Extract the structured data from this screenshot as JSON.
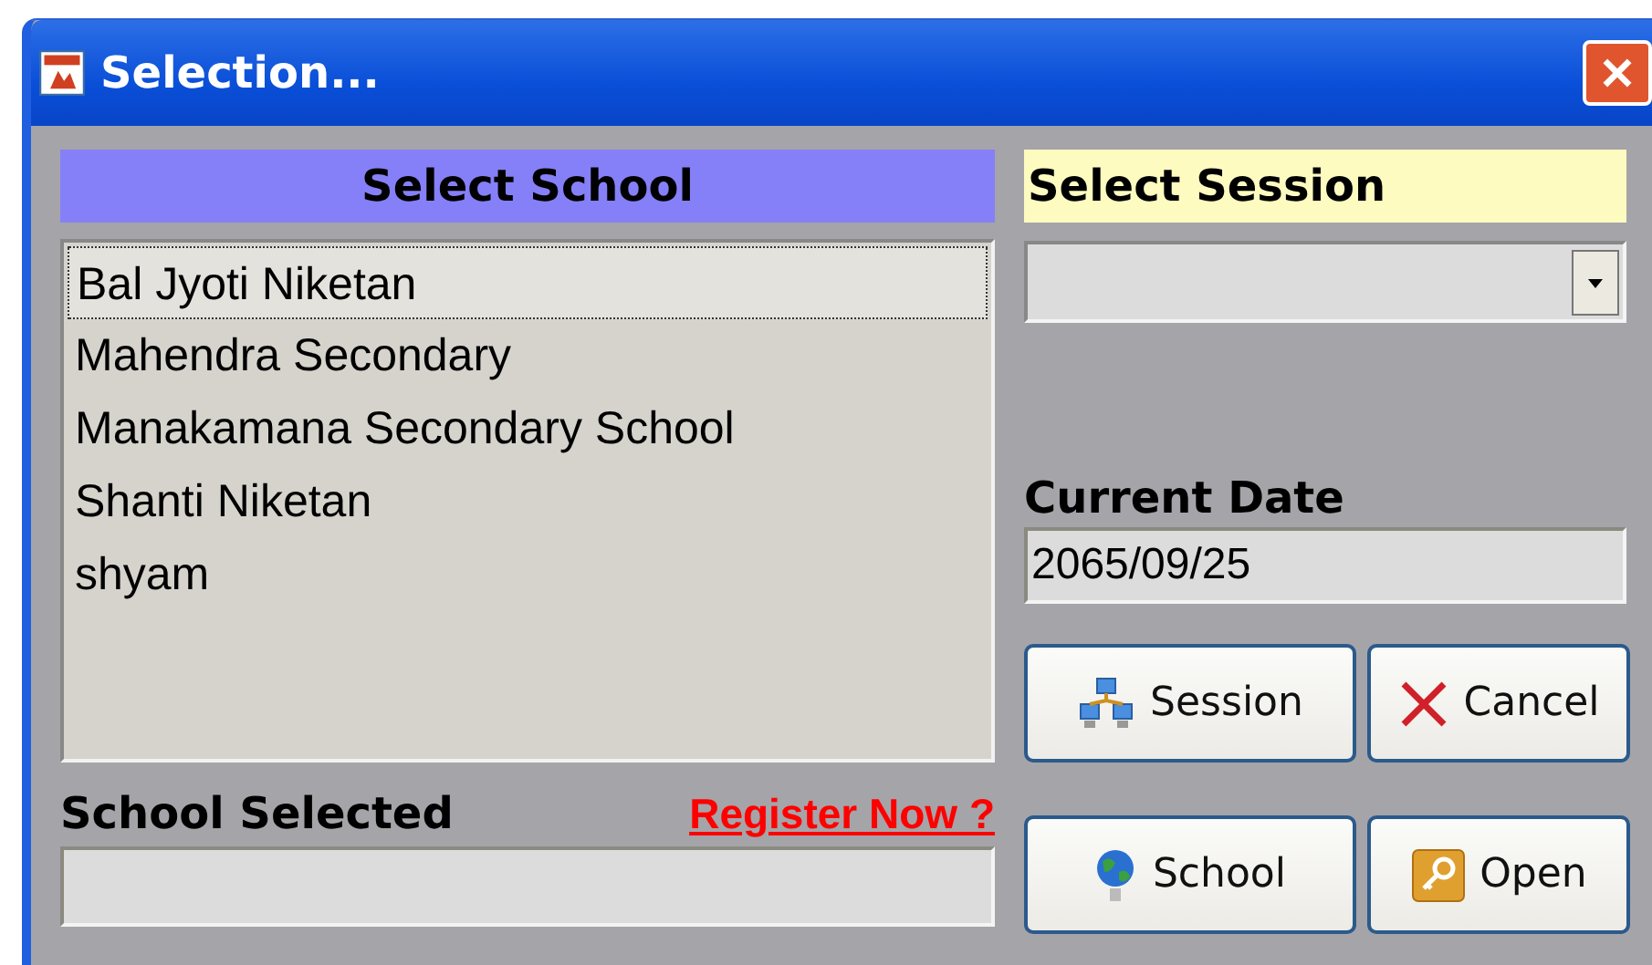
{
  "window": {
    "title": "Selection..."
  },
  "school_panel": {
    "header": "Select School",
    "schools": [
      {
        "name": "Bal Jyoti Niketan",
        "selected": true
      },
      {
        "name": "Mahendra Secondary",
        "selected": false
      },
      {
        "name": "Manakamana Secondary School",
        "selected": false
      },
      {
        "name": "Shanti Niketan",
        "selected": false
      },
      {
        "name": "shyam",
        "selected": false
      }
    ],
    "selected_label": "School Selected",
    "register_link": "Register Now ?"
  },
  "session_panel": {
    "header": "Select Session",
    "current_date_label": "Current Date",
    "current_date": "2065/09/25"
  },
  "buttons": [
    {
      "label": "Session",
      "kind": "session"
    },
    {
      "label": "Cancel",
      "kind": "cancel"
    },
    {
      "label": "School",
      "kind": "school"
    },
    {
      "label": "Open",
      "kind": "open"
    }
  ]
}
